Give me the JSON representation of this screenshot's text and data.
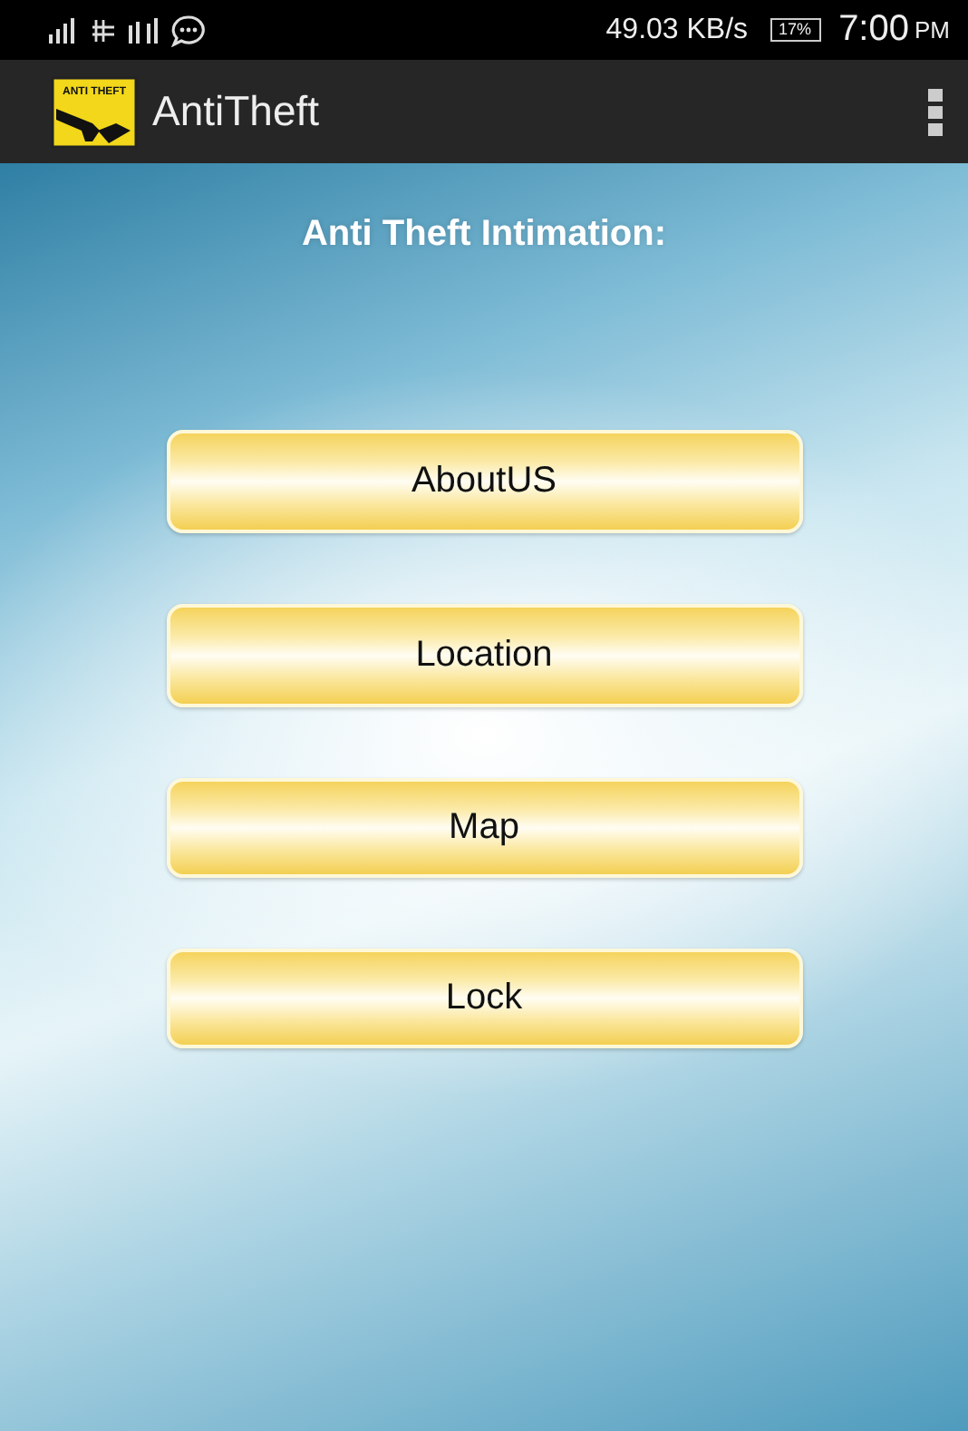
{
  "status_bar": {
    "speed": "49.03 KB/s",
    "battery": "17%",
    "time": "7:00",
    "meridiem": "PM"
  },
  "app_bar": {
    "logo_text": "ANTI THEFT",
    "title": "AntiTheft"
  },
  "heading": "Anti Theft Intimation:",
  "buttons": [
    {
      "label": "AboutUS"
    },
    {
      "label": "Location"
    },
    {
      "label": "Map"
    },
    {
      "label": "Lock"
    }
  ]
}
